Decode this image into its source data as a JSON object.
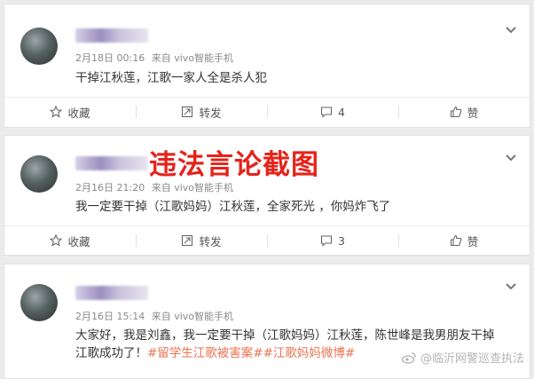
{
  "posts": [
    {
      "date": "2月18日 00:16",
      "source": "来自 vivo智能手机",
      "text": "干掉江秋莲，江歌一家人全是杀人犯",
      "actions": {
        "favorite": "收藏",
        "repost": "转发",
        "comment": "4",
        "like": "赞"
      }
    },
    {
      "date": "2月16日 21:20",
      "source": "来自 vivo智能手机",
      "text": "我一定要干掉（江歌妈妈）江秋莲，全家死光 ，你妈炸飞了",
      "actions": {
        "favorite": "收藏",
        "repost": "转发",
        "comment": "3",
        "like": "赞"
      }
    },
    {
      "date": "2月16日 15:14",
      "source": "来自 vivo智能手机",
      "text_line1": "大家好，我是刘鑫，我一定要干掉（江歌妈妈）江秋莲，陈世峰是我男朋友干掉",
      "text_line2": "江歌成功了！",
      "hashtags": "#留学生江歌被害案##江歌妈妈微博#"
    }
  ],
  "overlay_label": "违法言论截图",
  "watermark": "@临沂网警巡查执法",
  "colors": {
    "overlay": "#e5231b",
    "hashtag": "#eb7350",
    "meta": "#8a8a8a"
  }
}
